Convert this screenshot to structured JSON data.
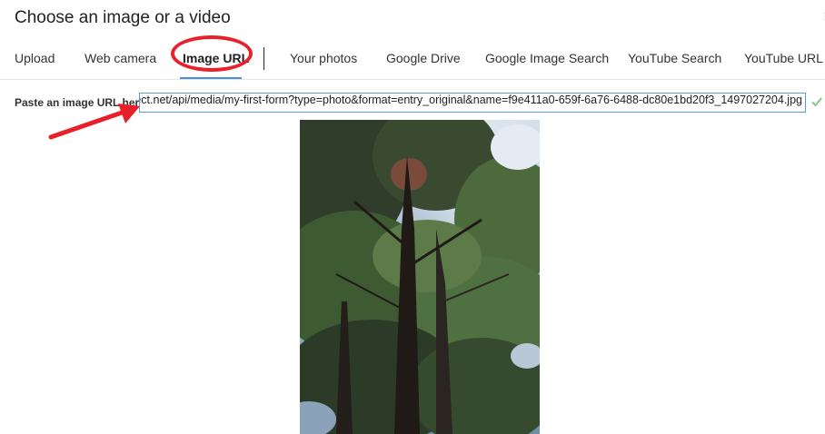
{
  "dialog": {
    "title": "Choose an image or a video"
  },
  "tabs": [
    {
      "label": "Upload"
    },
    {
      "label": "Web camera"
    },
    {
      "label": "Image URL",
      "active": true
    },
    {
      "label": "Your photos"
    },
    {
      "label": "Google Drive"
    },
    {
      "label": "Google Image Search"
    },
    {
      "label": "YouTube Search"
    },
    {
      "label": "YouTube URL"
    }
  ],
  "url_field": {
    "label": "Paste an image URL here:",
    "value": "https://www.ficollect.net/api/media/my-first-form?type=photo&format=entry_original&name=f9e411a0-659f-6a76-6488-dc80e1bd20f3_1497027204.jpg"
  },
  "preview": {
    "icon": "photo-preview"
  },
  "colors": {
    "accent": "#4a90e2",
    "annotation": "#e8202a",
    "input_border": "#5b9bd5"
  }
}
